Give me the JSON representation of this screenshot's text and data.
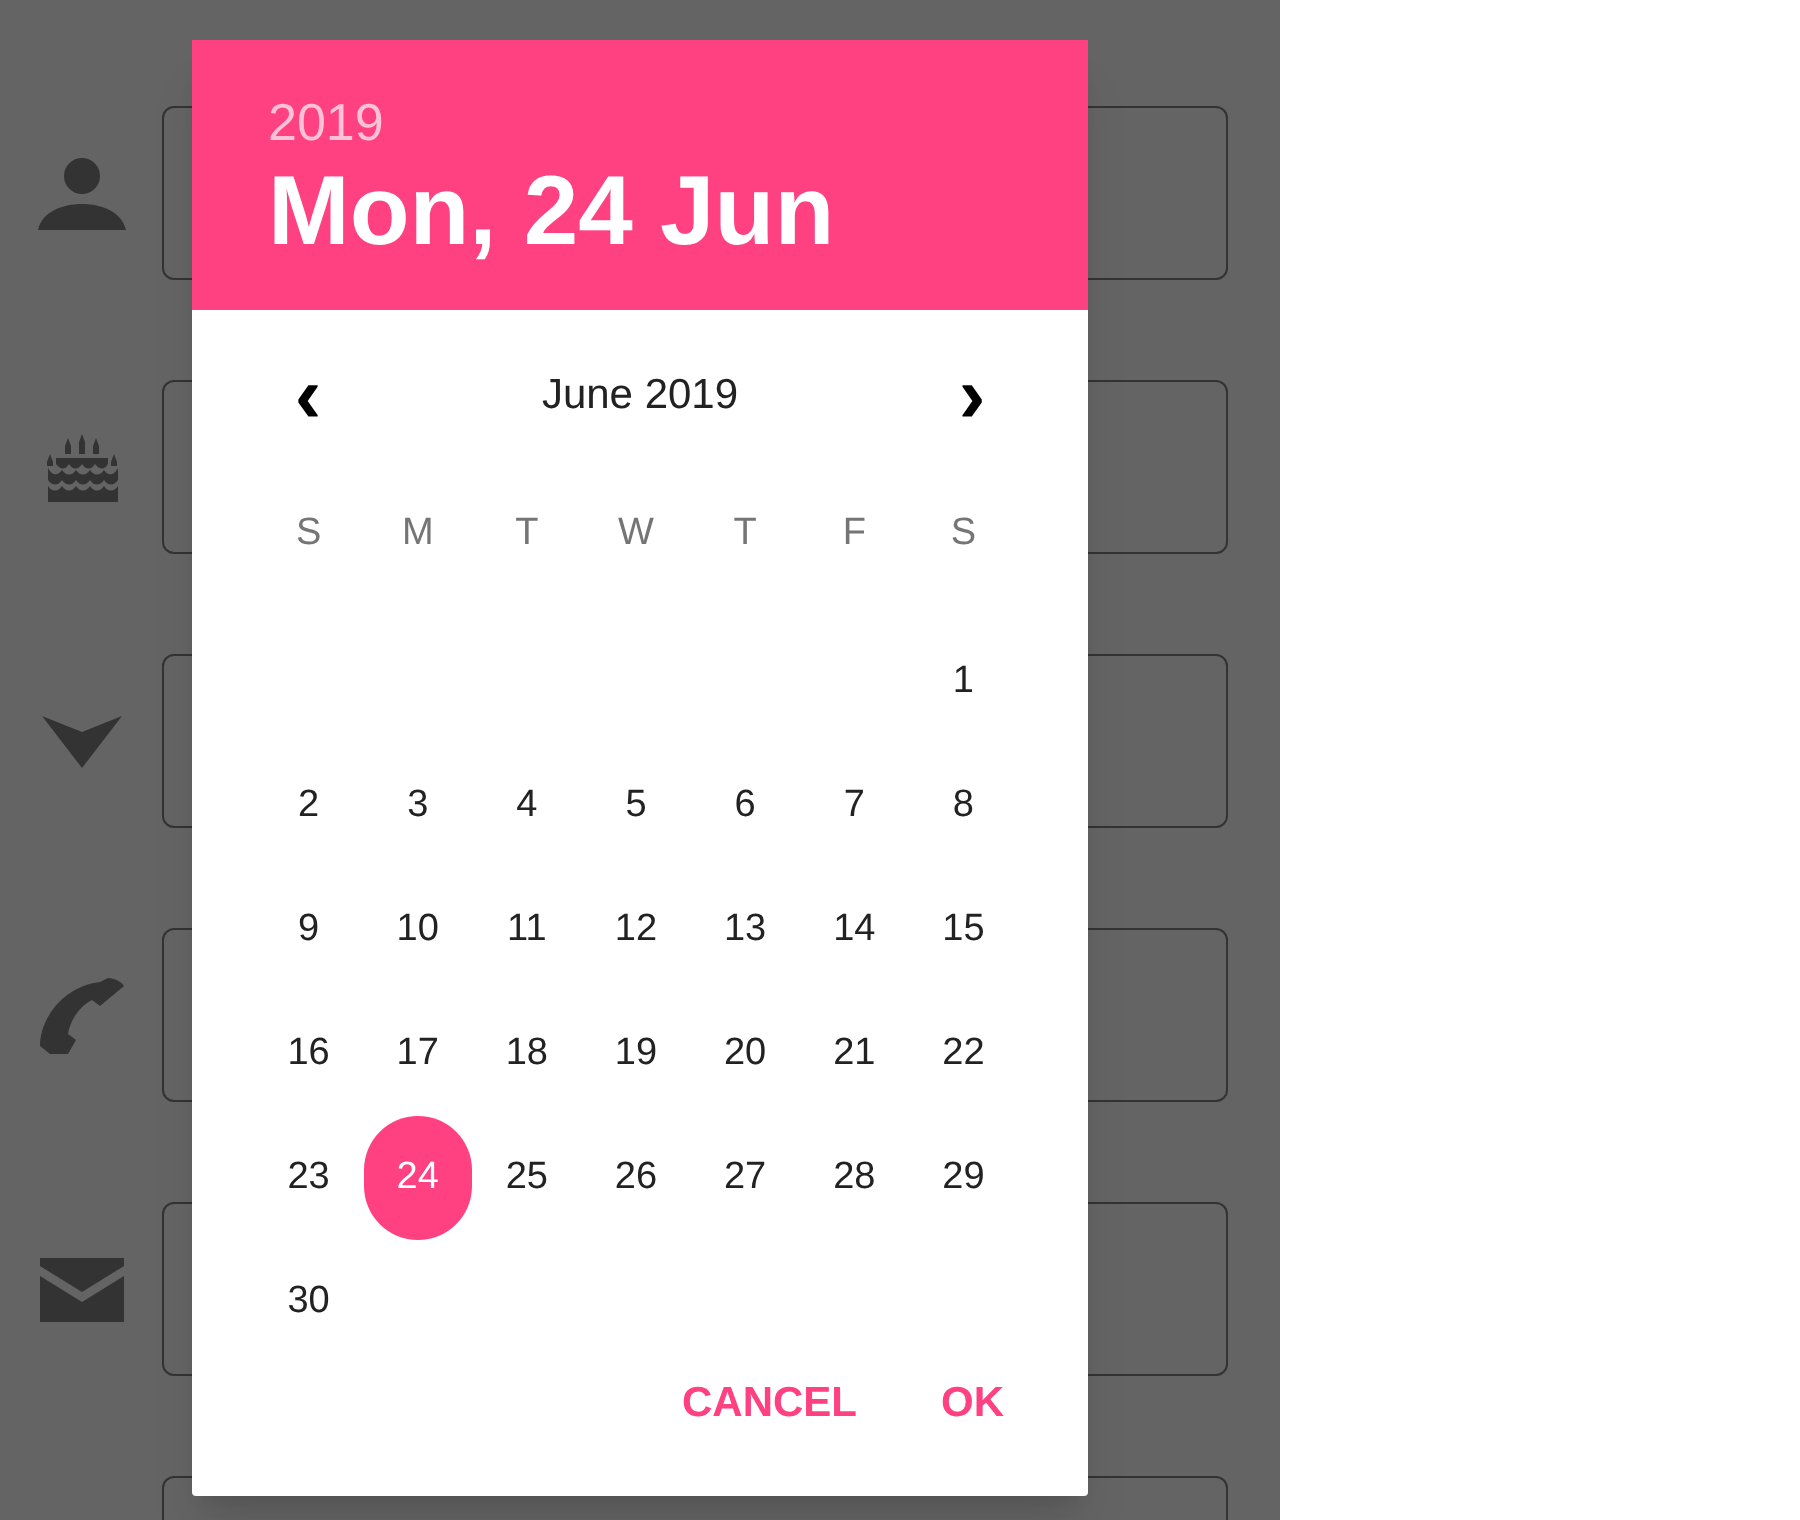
{
  "form": {
    "fields": [
      {
        "kind": "person"
      },
      {
        "kind": "cake"
      },
      {
        "kind": "arrow"
      },
      {
        "kind": "phone"
      },
      {
        "kind": "mail"
      },
      {
        "kind": "plain"
      }
    ]
  },
  "date_picker": {
    "year": "2019",
    "date": "Mon, 24 Jun",
    "month": "June 2019",
    "prev": "‹",
    "next": "›",
    "weekdays": [
      "S",
      "M",
      "T",
      "W",
      "T",
      "F",
      "S"
    ],
    "weeks": [
      [
        {
          "day": "1",
          "selected": false
        }
      ],
      [
        {
          "day": "2",
          "selected": false
        },
        {
          "day": "3",
          "selected": false
        },
        {
          "day": "4",
          "selected": false
        },
        {
          "day": "5",
          "selected": false
        },
        {
          "day": "6",
          "selected": false
        },
        {
          "day": "7",
          "selected": false
        },
        {
          "day": "8",
          "selected": false
        }
      ],
      [
        {
          "day": "9",
          "selected": false
        },
        {
          "day": "10",
          "selected": false
        },
        {
          "day": "11",
          "selected": false
        },
        {
          "day": "12",
          "selected": false
        },
        {
          "day": "13",
          "selected": false
        },
        {
          "day": "14",
          "selected": false
        },
        {
          "day": "15",
          "selected": false
        }
      ],
      [
        {
          "day": "16",
          "selected": false
        },
        {
          "day": "17",
          "selected": false
        },
        {
          "day": "18",
          "selected": false
        },
        {
          "day": "19",
          "selected": false
        },
        {
          "day": "20",
          "selected": false
        },
        {
          "day": "21",
          "selected": false
        },
        {
          "day": "22",
          "selected": false
        }
      ],
      [
        {
          "day": "23",
          "selected": false
        },
        {
          "day": "24",
          "selected": true
        },
        {
          "day": "25",
          "selected": false
        },
        {
          "day": "26",
          "selected": false
        },
        {
          "day": "27",
          "selected": false
        },
        {
          "day": "28",
          "selected": false
        },
        {
          "day": "29",
          "selected": false
        }
      ],
      [
        {
          "day": "30",
          "selected": false
        }
      ]
    ],
    "buttons": [
      "CANCEL",
      "OK"
    ]
  }
}
